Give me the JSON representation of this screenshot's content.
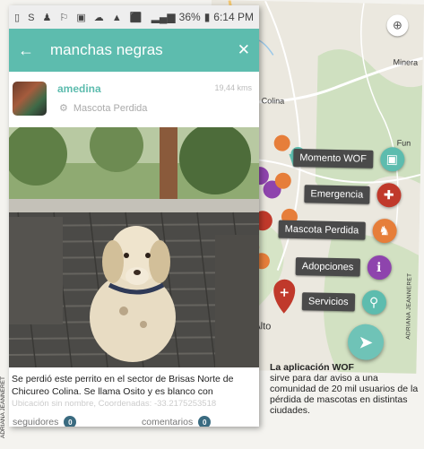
{
  "status_bar": {
    "battery": "36%",
    "time": "6:14 PM",
    "signal": "4G"
  },
  "search": {
    "query": "manchas negras"
  },
  "post": {
    "username": "amedina",
    "timestamp": "19,44 kms",
    "category": "Mascota Perdida",
    "caption": "Se perdió este perrito en el sector de Brisas Norte de Chicureo Colina. Se llama Osito y es blanco con",
    "location": "Ubicación sin nombre, Coordenadas: -33.2175253518",
    "followers_label": "seguidores",
    "followers_count": "0",
    "comments_label": "comentarios",
    "comments_count": "0"
  },
  "map": {
    "labels": {
      "minera": "Minera",
      "colina": "Colina",
      "alto": "Alto",
      "fun": "Fun"
    },
    "menu": [
      {
        "label": "Momento WOF",
        "icon": "camera-icon",
        "color": "#5dbcae"
      },
      {
        "label": "Emergencia",
        "icon": "plus-icon",
        "color": "#c0392b"
      },
      {
        "label": "Mascota Perdida",
        "icon": "dog-icon",
        "color": "#e67e3a"
      },
      {
        "label": "Adopciones",
        "icon": "info-icon",
        "color": "#8e44ad"
      },
      {
        "label": "Servicios",
        "icon": "pin-icon",
        "color": "#5dbcae"
      }
    ]
  },
  "credits": {
    "left": "ADRIANA JEANNERET",
    "right": "ADRIANA JEANNERET"
  },
  "article": {
    "lead": "La aplicación WOF",
    "body": "sirve para dar aviso a una comunidad de 20 mil usuarios de la pérdida de mascotas en distintas ciudades."
  }
}
